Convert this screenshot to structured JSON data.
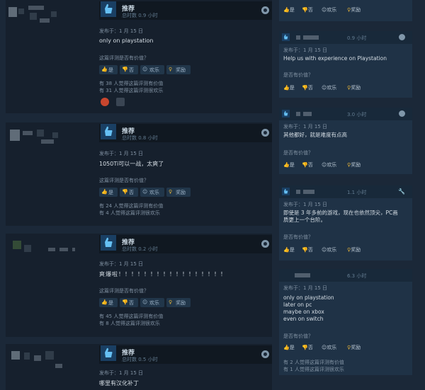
{
  "left_reviews": [
    {
      "recommendation": "推荐",
      "hours": "总时数 0.9 小时",
      "posted": "发布于：1 月 15 日",
      "text": "only on playstation",
      "helpful_question": "这篇评测是否有价值？",
      "buttons": {
        "yes": "是",
        "no": "否",
        "funny": "欢乐",
        "award": "奖励"
      },
      "stats": [
        "有 38 人觉得这篇评测有价值",
        "有 31 人觉得这篇评测很欢乐"
      ],
      "has_awards": true
    },
    {
      "recommendation": "推荐",
      "hours": "总时数 0.8 小时",
      "posted": "发布于：1 月 15 日",
      "text": "1050Ti可以一战，太爽了",
      "helpful_question": "这篇评测是否有价值？",
      "buttons": {
        "yes": "是",
        "no": "否",
        "funny": "欢乐",
        "award": "奖励"
      },
      "stats": [
        "有 24 人觉得这篇评测有价值",
        "有 4 人觉得这篇评测很欢乐"
      ],
      "has_awards": false
    },
    {
      "recommendation": "推荐",
      "hours": "总时数 0.2 小时",
      "posted": "发布于：1 月 15 日",
      "text": "爽爆啦！！！！！！！！！！！！！！！！！",
      "helpful_question": "这篇评测是否有价值？",
      "buttons": {
        "yes": "是",
        "no": "否",
        "funny": "欢乐",
        "award": "奖励"
      },
      "stats": [
        "有 45 人觉得这篇评测有价值",
        "有 8 人觉得这篇评测很欢乐"
      ],
      "has_awards": false
    },
    {
      "recommendation": "推荐",
      "hours": "总时数 0.5 小时",
      "posted": "发布于：1 月 15 日",
      "text": "哪里有汉化补丁",
      "has_awards": false
    }
  ],
  "right_top": {
    "buttons": {
      "yes": "是",
      "no": "否",
      "funny": "欢乐",
      "award": "奖励"
    }
  },
  "right_reviews": [
    {
      "hours": "0.9 小时",
      "posted": "发布于：1 月 15 日",
      "lines": [
        "Help us with experience on Playstation"
      ],
      "helpful_question": "是否有价值？",
      "buttons": {
        "yes": "是",
        "no": "否",
        "funny": "欢乐",
        "award": "奖励"
      },
      "stats": []
    },
    {
      "hours": "3.0 小时",
      "posted": "发布于：1 月 15 日",
      "lines": [
        "其他都好，就是难度有点高"
      ],
      "helpful_question": "是否有价值？",
      "buttons": {
        "yes": "是",
        "no": "否",
        "funny": "欢乐",
        "award": "奖励"
      },
      "stats": []
    },
    {
      "hours": "1.1 小时",
      "posted": "发布于：1 月 15 日",
      "lines": [
        "即使是 3 年多前的游戏，现在也依然顶尖，PC画",
        "质更上一个台阶。"
      ],
      "helpful_question": "是否有价值？",
      "buttons": {
        "yes": "是",
        "no": "否",
        "funny": "欢乐",
        "award": "奖励"
      },
      "stats": []
    },
    {
      "hours": "6.3 小时",
      "posted": "发布于：1 月 15 日",
      "lines": [
        "only on playstation",
        "later on pc",
        "maybe on xbox",
        "even on switch"
      ],
      "helpful_question": "是否有价值？",
      "buttons": {
        "yes": "是",
        "no": "否",
        "funny": "欢乐",
        "award": "奖励"
      },
      "stats": [
        "有 2 人觉得这篇评测有价值",
        "有 1 人觉得这篇评测很欢乐"
      ]
    }
  ],
  "icons": {
    "thumb_up": "thumbs-up-icon",
    "thumb_down": "thumbs-down-icon",
    "funny": "smiley-icon",
    "award": "award-icon",
    "steam": "steam-icon",
    "key": "key-icon"
  },
  "colors": {
    "background": "#1b2838",
    "card": "#16202d",
    "right_card": "#1f3246",
    "thumb_bg": "#1a3f63",
    "accent": "#66c0f4",
    "award": "#e1b13a"
  }
}
